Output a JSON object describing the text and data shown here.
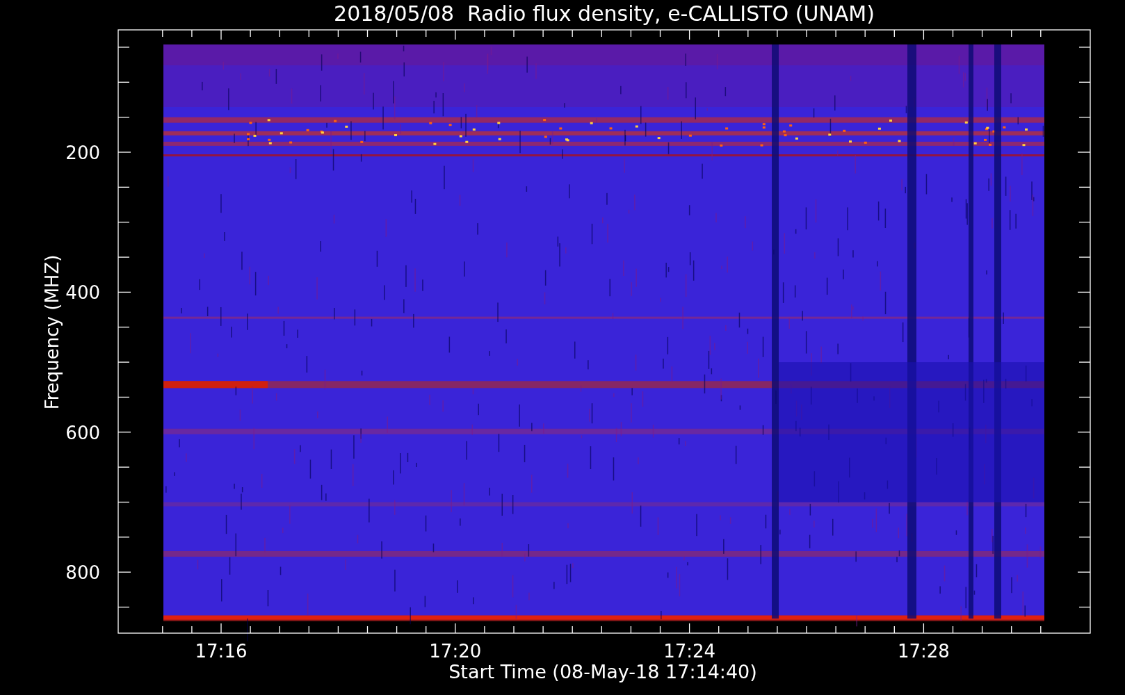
{
  "title": "2018/05/08  Radio flux density, e-CALLISTO (UNAM)",
  "y_axis": {
    "label": "Frequency (MHZ)",
    "ticks": [
      "200",
      "400",
      "600",
      "800"
    ]
  },
  "x_axis": {
    "label": "Start Time (08-May-18 17:14:40)",
    "ticks": [
      "17:16",
      "17:20",
      "17:24",
      "17:28"
    ]
  }
}
